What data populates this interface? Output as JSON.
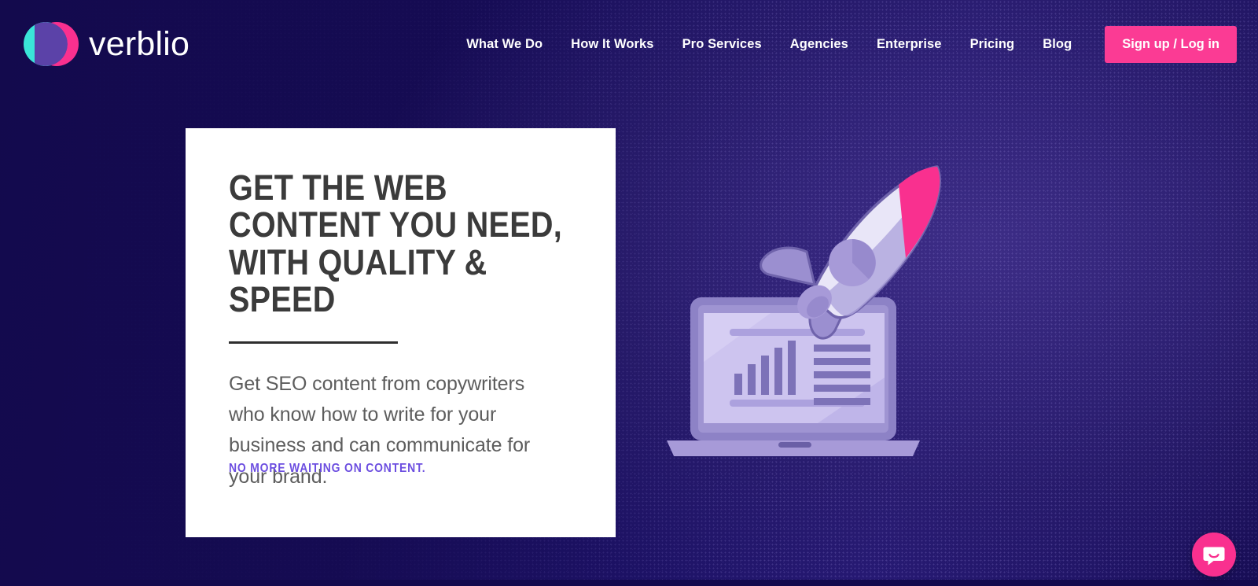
{
  "brand": {
    "name": "verblio",
    "logo_icon": "verblio-circles-logo",
    "colors": {
      "teal": "#3ae5d8",
      "pink": "#f9308f",
      "overlap_purple": "#5b42a8"
    }
  },
  "header": {
    "nav_items": [
      {
        "label": "What We Do",
        "name": "nav-what-we-do"
      },
      {
        "label": "How It Works",
        "name": "nav-how-it-works"
      },
      {
        "label": "Pro Services",
        "name": "nav-pro-services"
      },
      {
        "label": "Agencies",
        "name": "nav-agencies"
      },
      {
        "label": "Enterprise",
        "name": "nav-enterprise"
      },
      {
        "label": "Pricing",
        "name": "nav-pricing"
      },
      {
        "label": "Blog",
        "name": "nav-blog"
      }
    ],
    "cta": {
      "label": "Sign up / Log in",
      "color": "#fb3b94"
    }
  },
  "hero": {
    "title": "GET THE WEB CONTENT YOU NEED, WITH QUALITY & SPEED",
    "body": "Get SEO content from copywriters who know how to write for your business and can communicate for your brand.",
    "tagline": "NO MORE WAITING ON CONTENT.",
    "tagline_color": "#6c4ee0",
    "card_background": "#ffffff",
    "background_colors": {
      "dark_navy": "#130a4d",
      "indigo": "#241774"
    }
  },
  "illustration": {
    "name": "rocket-launching-from-laptop",
    "rocket": {
      "nose_color": "#f9308f",
      "body_color": "#e9e6f8",
      "body_shade": "#b0a6dd",
      "fin_color": "#9b8fd0",
      "porthole_color": "#a79ad8",
      "flame_color": "#eaf83c"
    },
    "laptop": {
      "shell_color": "#8d82c6",
      "screen_color": "#cdc4ef",
      "content_color": "#7d72b8",
      "base_color": "#a79ad8",
      "chart_bars": 5,
      "text_lines": 5
    }
  },
  "chat_widget": {
    "name": "intercom-chat-launcher",
    "icon": "chat-bubble-smile-icon",
    "color": "#f9308f"
  }
}
